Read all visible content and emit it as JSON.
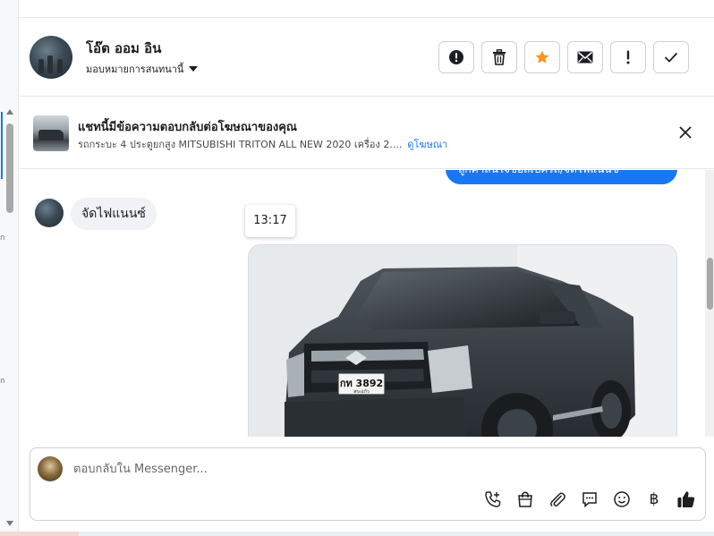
{
  "header": {
    "contact_name": "โอ๊ต ออม อิน",
    "assign_label": "มอบหมายการสนทนานี้"
  },
  "actions": [
    {
      "name": "report-icon"
    },
    {
      "name": "trash-icon"
    },
    {
      "name": "star-icon",
      "color": "#f7931e"
    },
    {
      "name": "envelope-icon"
    },
    {
      "name": "exclamation-icon"
    },
    {
      "name": "check-icon"
    }
  ],
  "ad_banner": {
    "title": "แชทนี้มีข้อความตอบกลับต่อโฆษณาของคุณ",
    "subtitle": "รถกระบะ 4 ประตูยกสูง MITSUBISHI TRITON ALL NEW 2020 เครื่อง 2....",
    "link_text": "ดูโฆษณา"
  },
  "messages": {
    "outgoing_partial": "ลูกค้าสนใจขอสเปครถ/จัดไฟแนนซ์",
    "incoming_text": "จัดไฟแนนซ์",
    "timestamp": "13:17",
    "plate_text": "กท 3892",
    "plate_sub": "สระแก้ว"
  },
  "composer": {
    "placeholder": "ตอบกลับใน Messenger..."
  },
  "tools": [
    {
      "name": "call-icon"
    },
    {
      "name": "shopping-bag-icon"
    },
    {
      "name": "paperclip-icon"
    },
    {
      "name": "saved-reply-icon"
    },
    {
      "name": "emoji-icon"
    },
    {
      "name": "baht-icon",
      "glyph": "฿"
    },
    {
      "name": "thumbs-up-icon"
    }
  ],
  "colors": {
    "accent": "#1877f2",
    "star": "#f7931e",
    "text": "#1c1e21",
    "border": "#ced0d4"
  }
}
